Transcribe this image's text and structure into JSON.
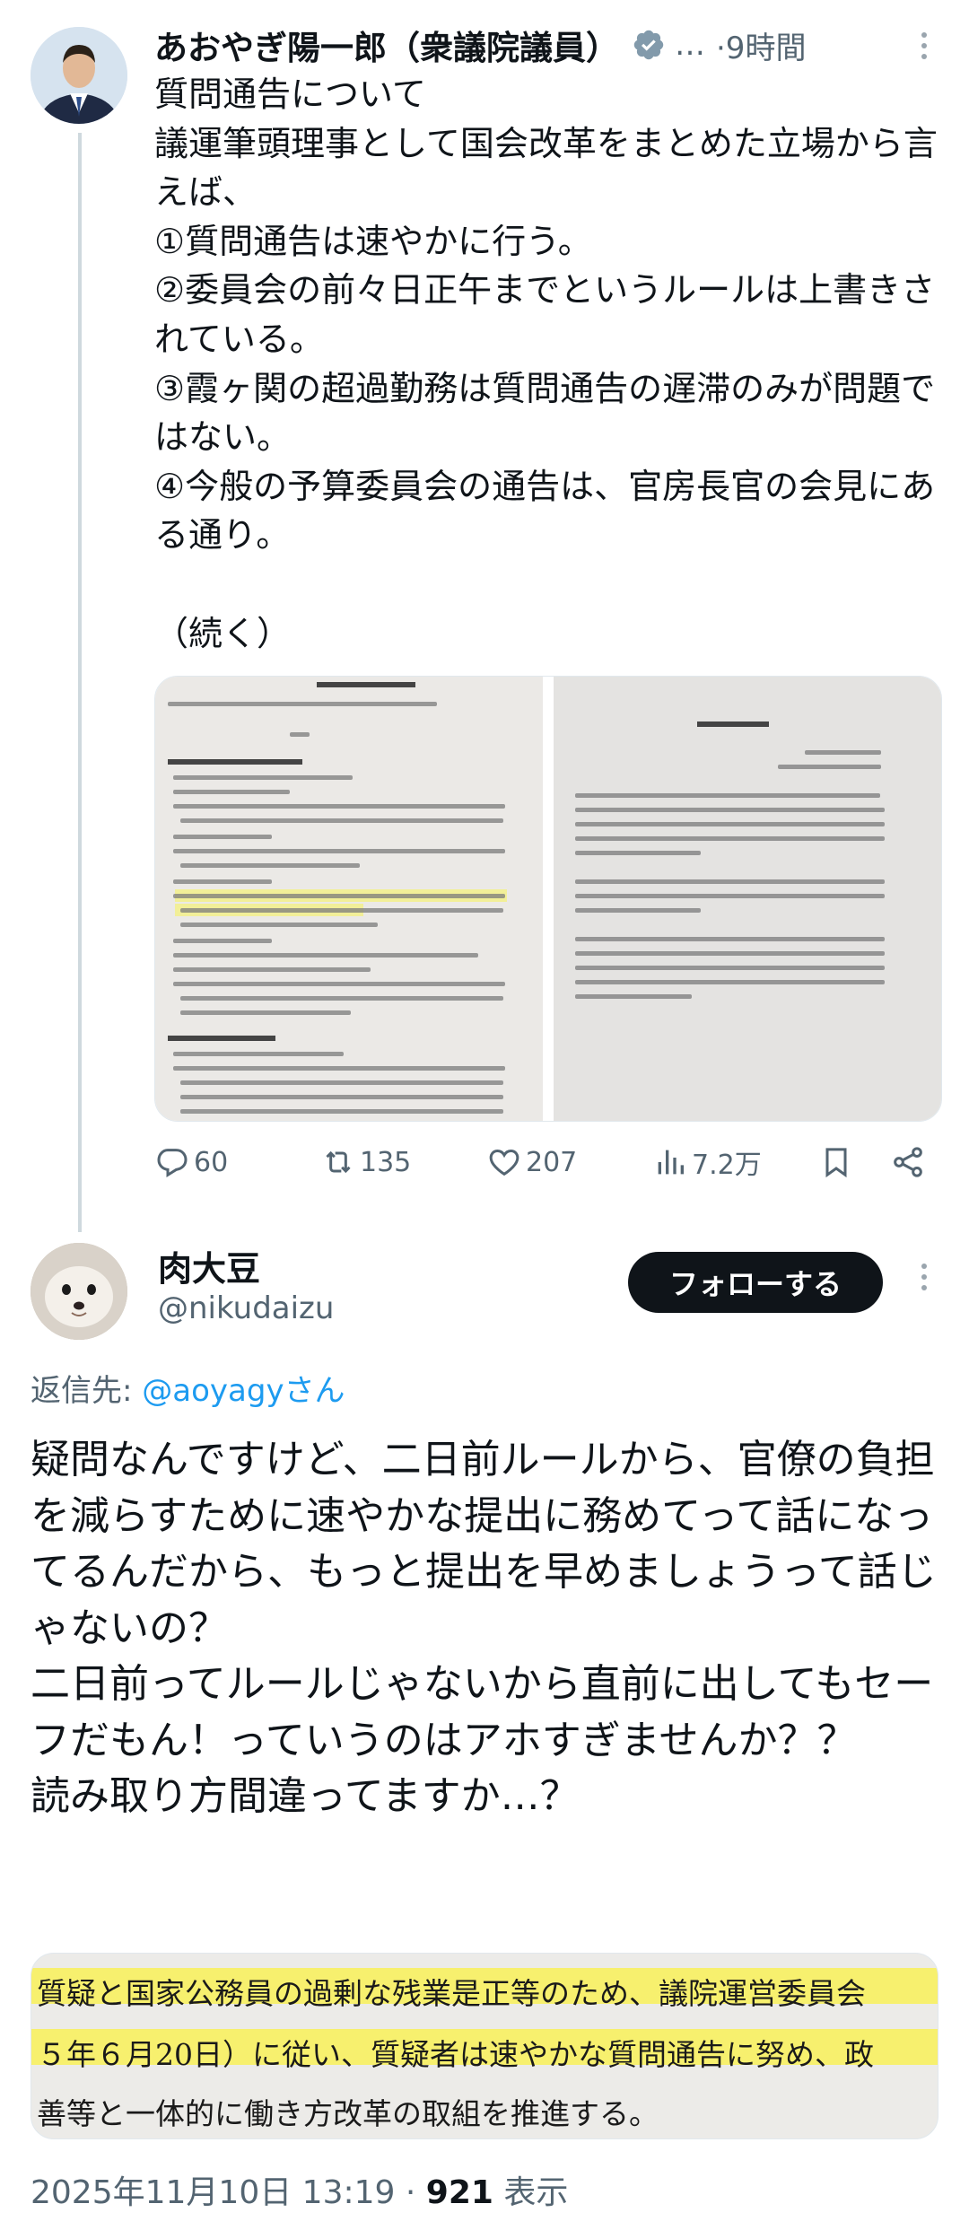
{
  "parent_tweet": {
    "author_name": "あおやぎ陽一郎（衆議院議員）",
    "truncation": "…",
    "time": "·9時間",
    "body": "質問通告について\n議運筆頭理事として国会改革をまとめた立場から言えば、\n①質問通告は速やかに行う。\n②委員会の前々日正午までというルールは上書きされている。\n③霞ヶ関の超過勤務は質問通告の遅滞のみが問題ではない。\n④今般の予算委員会の通告は、官房長官の会見にある通り。\n\n（続く）",
    "actions": {
      "replies": "60",
      "retweets": "135",
      "likes": "207",
      "views": "7.2万"
    },
    "icons": [
      "verified-badge-icon",
      "more-icon",
      "reply-icon",
      "retweet-icon",
      "like-icon",
      "views-icon",
      "bookmark-icon",
      "share-icon"
    ]
  },
  "reply_tweet": {
    "author_name": "肉大豆",
    "handle": "@nikudaizu",
    "follow_label": "フォローする",
    "reply_to_prefix": "返信先: ",
    "reply_to_mention": "@aoyagy",
    "reply_to_suffix": "さん",
    "body": "疑問なんですけど、二日前ルールから、官僚の負担を減らすために速やかな提出に務めてって話になってるんだから、もっと提出を早めましょうって話じゃないの？\n二日前ってルールじゃないから直前に出してもセーフだもん！っていうのはアホすぎませんか？？\n読み取り方間違ってますか…？",
    "quote_lines": [
      "質疑と国家公務員の過剰な残業是正等のため、議院運営委員会",
      "５年６月20日）に従い、質疑者は速やかな質問通告に努め、政",
      "善等と一体的に働き方改革の取組を推進する。"
    ],
    "date": "2025年11月10日 13:19",
    "separator": " · ",
    "views_count": "921",
    "views_label": " 表示"
  },
  "colors": {
    "text": "#0f1419",
    "secondary": "#536471",
    "link": "#1d9bf0",
    "verified": "#829aab",
    "highlight": "#f7f06e"
  }
}
